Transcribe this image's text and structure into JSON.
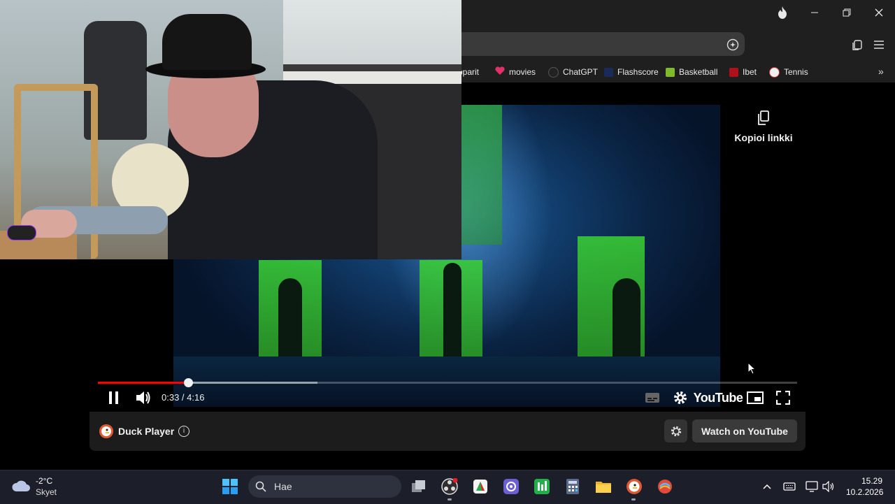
{
  "browser": {
    "bookmarks": [
      {
        "label": "pparit",
        "icon": "none"
      },
      {
        "label": "movies",
        "icon": "heart-icon",
        "color": "#e0306a"
      },
      {
        "label": "ChatGPT",
        "icon": "chatgpt-icon",
        "color": "#222"
      },
      {
        "label": "Flashscore",
        "icon": "flashscore-icon",
        "color": "#1a2b5a"
      },
      {
        "label": "Basketball",
        "icon": "basketball-icon",
        "color": "#7dbb2a"
      },
      {
        "label": "Ibet",
        "icon": "ibet-icon",
        "color": "#b0101a"
      },
      {
        "label": "Tennis",
        "icon": "tennis-icon",
        "color": "#f0f0f0"
      }
    ]
  },
  "player": {
    "copy_link_label": "Kopioi linkki",
    "time_display": "0:33 / 4:16",
    "progress_fraction": 0.129,
    "buffer_fraction": 0.314,
    "youtube_logo_text": "YouTube"
  },
  "duck_player": {
    "title": "Duck Player",
    "watch_label": "Watch on YouTube"
  },
  "taskbar": {
    "weather_temp": "-2°C",
    "weather_desc": "Skyet",
    "search_placeholder": "Hae",
    "clock_time": "15.29",
    "clock_date": "10.2.2026"
  },
  "colors": {
    "progress": "#ff0000",
    "duck_brand": "#de5833"
  }
}
